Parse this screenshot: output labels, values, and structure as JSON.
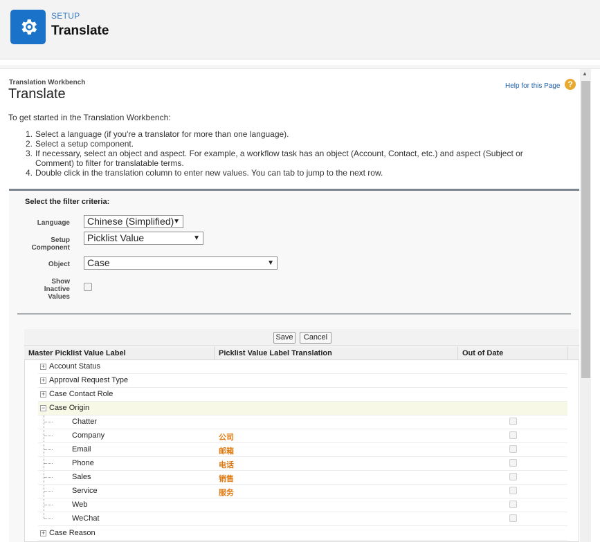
{
  "header": {
    "setup_label": "SETUP",
    "title": "Translate",
    "icon": "gear-icon",
    "icon_color": "#1a73c8"
  },
  "page": {
    "breadcrumb": "Translation Workbench",
    "title": "Translate",
    "help_link": "Help for this Page",
    "help_icon": "?"
  },
  "intro": "To get started in the Translation Workbench:",
  "steps": [
    {
      "num": "1.",
      "text": "Select a language (if you're a translator for more than one language)."
    },
    {
      "num": "2.",
      "text": "Select a setup component."
    },
    {
      "num": "3.",
      "text": "If necessary, select an object and aspect. For example, a workflow task has an object (Account, Contact, etc.) and aspect (Subject or Comment) to filter for translatable terms."
    },
    {
      "num": "4.",
      "text": "Double click in the translation column to enter new values. You can tab to jump to the next row."
    }
  ],
  "filter": {
    "heading": "Select the filter criteria:",
    "language_label": "Language",
    "language_value": "Chinese (Simplified)",
    "component_label_1": "Setup",
    "component_label_2": "Component",
    "component_value": "Picklist Value",
    "object_label": "Object",
    "object_value": "Case",
    "inactive_label_1": "Show",
    "inactive_label_2": "Inactive",
    "inactive_label_3": "Values",
    "caret": "▼"
  },
  "table": {
    "save_label": "Save",
    "cancel_label": "Cancel",
    "columns": [
      "Master Picklist Value Label",
      "Picklist Value Label Translation",
      "Out of Date"
    ],
    "parent_rows": [
      {
        "label": "Account Status",
        "expanded": false
      },
      {
        "label": "Approval Request Type",
        "expanded": false
      },
      {
        "label": "Case Contact Role",
        "expanded": false
      },
      {
        "label": "Case Origin",
        "expanded": true
      }
    ],
    "child_rows": [
      {
        "label": "Chatter",
        "translation": ""
      },
      {
        "label": "Company",
        "translation": "公司"
      },
      {
        "label": "Email",
        "translation": "邮箱"
      },
      {
        "label": "Phone",
        "translation": "电话"
      },
      {
        "label": "Sales",
        "translation": "销售"
      },
      {
        "label": "Service",
        "translation": "服务"
      },
      {
        "label": "Web",
        "translation": ""
      },
      {
        "label": "WeChat",
        "translation": ""
      }
    ],
    "last_row": {
      "label": "Case Reason",
      "expanded": false
    },
    "plus": "+",
    "minus": "−",
    "translation_color": "#e07b14"
  }
}
